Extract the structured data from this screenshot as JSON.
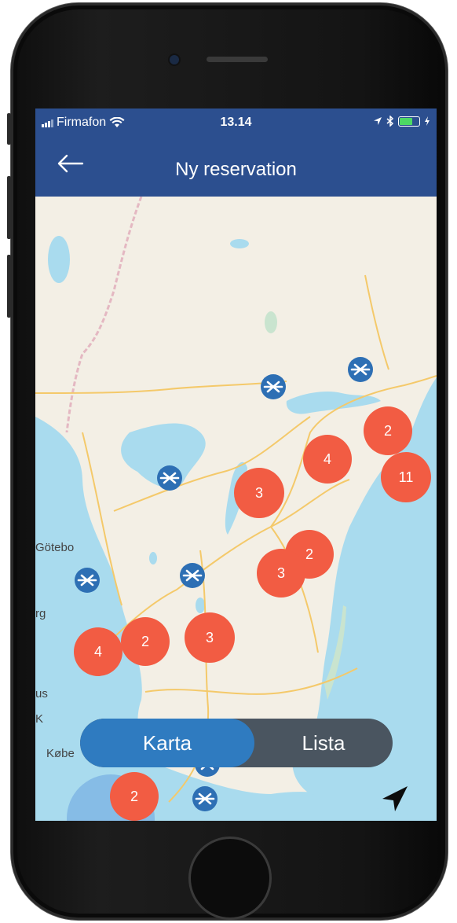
{
  "status_bar": {
    "carrier": "Firmafon",
    "time": "13.14",
    "icons": [
      "signal-icon",
      "wifi-icon",
      "location-arrow-icon",
      "bluetooth-icon",
      "battery-icon",
      "charging-icon"
    ]
  },
  "header": {
    "back_icon": "back-arrow-icon",
    "title": "Ny reservation"
  },
  "map": {
    "labels": [
      "Götebo",
      "rg",
      "us",
      "K",
      "Købe"
    ],
    "clusters": [
      "2",
      "4",
      "11",
      "3",
      "2",
      "3",
      "4",
      "2",
      "3",
      "2"
    ],
    "location_pins": 10,
    "pin_icon": "hub-marker-icon"
  },
  "view_toggle": {
    "selected": "Karta",
    "options": [
      "Karta",
      "Lista"
    ]
  },
  "locate_icon": "location-arrow-icon",
  "colors": {
    "header": "#2c4f8f",
    "cluster": "#f25c43",
    "pin": "#2d6fb4",
    "toggle_active": "#2f7bc0",
    "toggle_inactive": "#4a5560",
    "water": "#a9dbee",
    "land": "#f3efe5"
  }
}
